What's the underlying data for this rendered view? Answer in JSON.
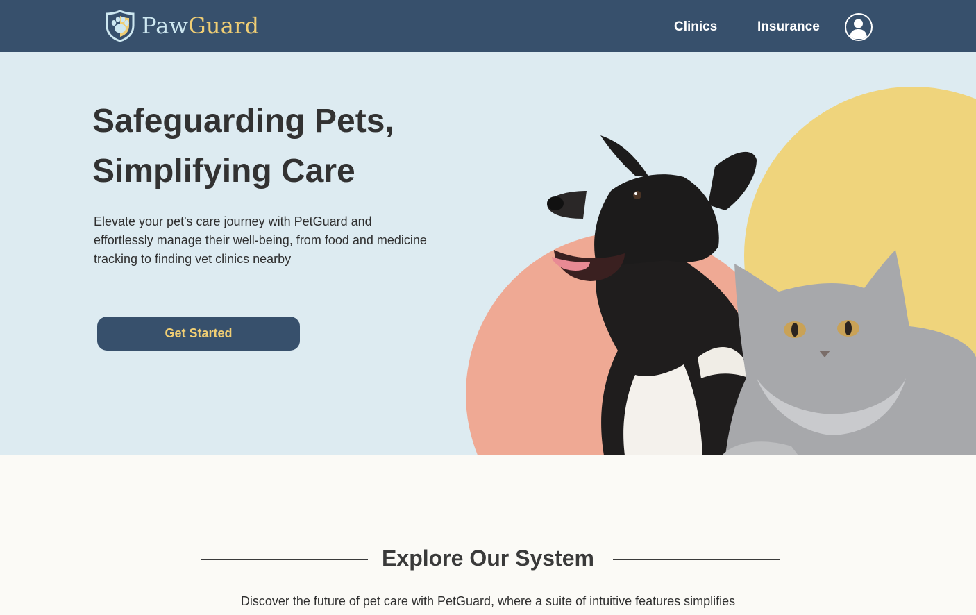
{
  "header": {
    "brand_part1": "Paw",
    "brand_part2": "Guard",
    "nav": [
      "Clinics",
      "Insurance"
    ],
    "account_icon": "user-circle-icon"
  },
  "hero": {
    "title_line1": "Safeguarding Pets,",
    "title_line2": "Simplifying Care",
    "subtitle": "Elevate your pet's care journey with PetGuard and effortlessly manage their well-being, from food and medicine tracking to finding vet clinics nearby",
    "cta_label": "Get Started",
    "image_subject": "dog-and-cat-photo"
  },
  "explore": {
    "title": "Explore Our System",
    "text": "Discover the future of pet care with PetGuard, where a suite of intuitive features simplifies"
  },
  "colors": {
    "navy": "#37506c",
    "gold": "#f0ce74",
    "hero_bg": "#ddebf1",
    "salmon": "#efa994",
    "page_bg": "#fbfaf6"
  }
}
